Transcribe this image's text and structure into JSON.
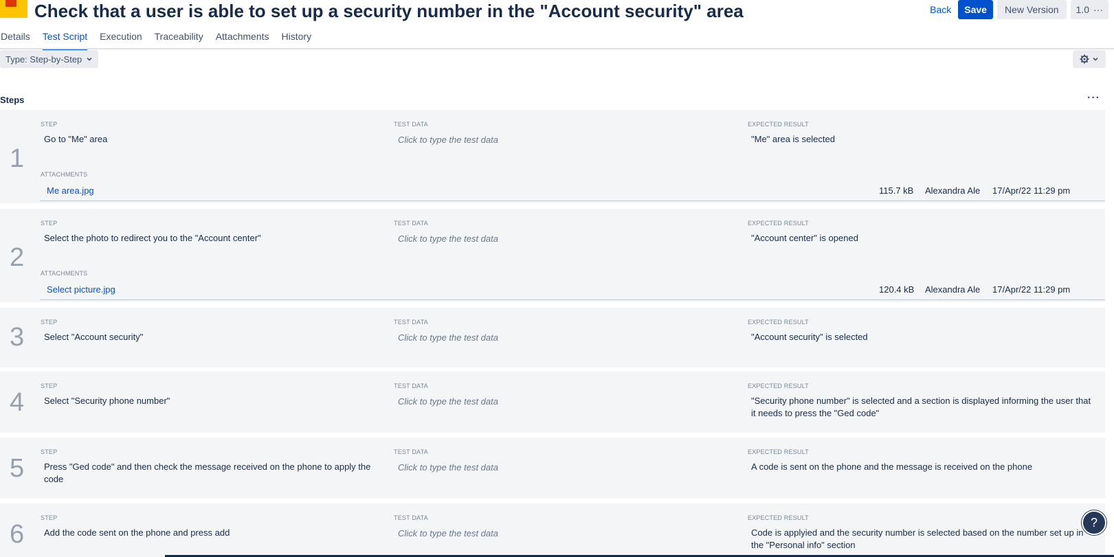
{
  "header": {
    "title": "Check that a user is able to set up a security number in the \"Account security\" area",
    "back_label": "Back",
    "save_label": "Save",
    "new_version_label": "New Version",
    "version": "1.0",
    "version_more": "···"
  },
  "tabs": [
    {
      "label": "Details"
    },
    {
      "label": "Test Script"
    },
    {
      "label": "Execution"
    },
    {
      "label": "Traceability"
    },
    {
      "label": "Attachments"
    },
    {
      "label": "History"
    }
  ],
  "toolbar": {
    "type_label": "Type: Step-by-Step",
    "gear_icon": "gear-icon"
  },
  "steps_section": {
    "label": "Steps",
    "more": "···",
    "col_step": "STEP",
    "col_test_data": "TEST DATA",
    "col_expected": "EXPECTED RESULT",
    "col_attachments": "ATTACHMENTS"
  },
  "steps": [
    {
      "num": "1",
      "step": "Go to \"Me\" area",
      "test_data": "Click to type the test data",
      "expected": "\"Me\" area is selected",
      "attachment": {
        "name": "Me area.jpg",
        "size": "115.7 kB",
        "author": "Alexandra Ale",
        "date": "17/Apr/22 11:29 pm"
      }
    },
    {
      "num": "2",
      "step": "Select the photo to redirect you to the \"Account center\"",
      "test_data": "Click to type the test data",
      "expected": "\"Account center\" is opened",
      "attachment": {
        "name": "Select picture.jpg",
        "size": "120.4 kB",
        "author": "Alexandra Ale",
        "date": "17/Apr/22 11:29 pm"
      }
    },
    {
      "num": "3",
      "step": "Select \"Account security\"",
      "test_data": "Click to type the test data",
      "expected": "\"Account security\" is selected"
    },
    {
      "num": "4",
      "step": "Select \"Security phone number\"",
      "test_data": "Click to type the test data",
      "expected_line1": "\"Security phone number\" is selected and a section is displayed informing the user that",
      "expected_line2": "it needs to press the \"Ged code\""
    },
    {
      "num": "5",
      "step_line1": "Press \"Ged code\" and then check the message received on the phone to apply the",
      "step_line2": "code",
      "test_data": "Click to type the test data",
      "expected": "A code is sent on the phone and the message is received on the phone"
    },
    {
      "num": "6",
      "step": "Add the code sent on the phone and press add",
      "test_data": "Click to type the test data",
      "expected_line1": "Code is applyied and the security number is selected based on the number set up in",
      "expected_line2": "the \"Personal info\" section"
    }
  ],
  "help": "?"
}
